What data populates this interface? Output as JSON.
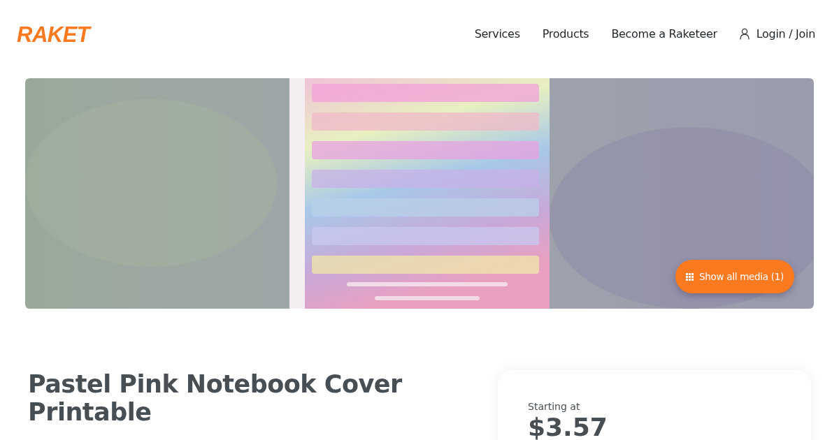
{
  "header": {
    "logo": "RAKET",
    "nav": [
      {
        "label": "Services",
        "kind": "link"
      },
      {
        "label": "Products",
        "kind": "link"
      },
      {
        "label": "Become a Raketeer",
        "kind": "link"
      },
      {
        "label": "Login / Join",
        "kind": "account"
      }
    ]
  },
  "hero": {
    "show_media_button": "Show all media (1)"
  },
  "product": {
    "title": "Pastel Pink Notebook Cover Printable",
    "price_label": "Starting at",
    "price": "$3.57"
  }
}
